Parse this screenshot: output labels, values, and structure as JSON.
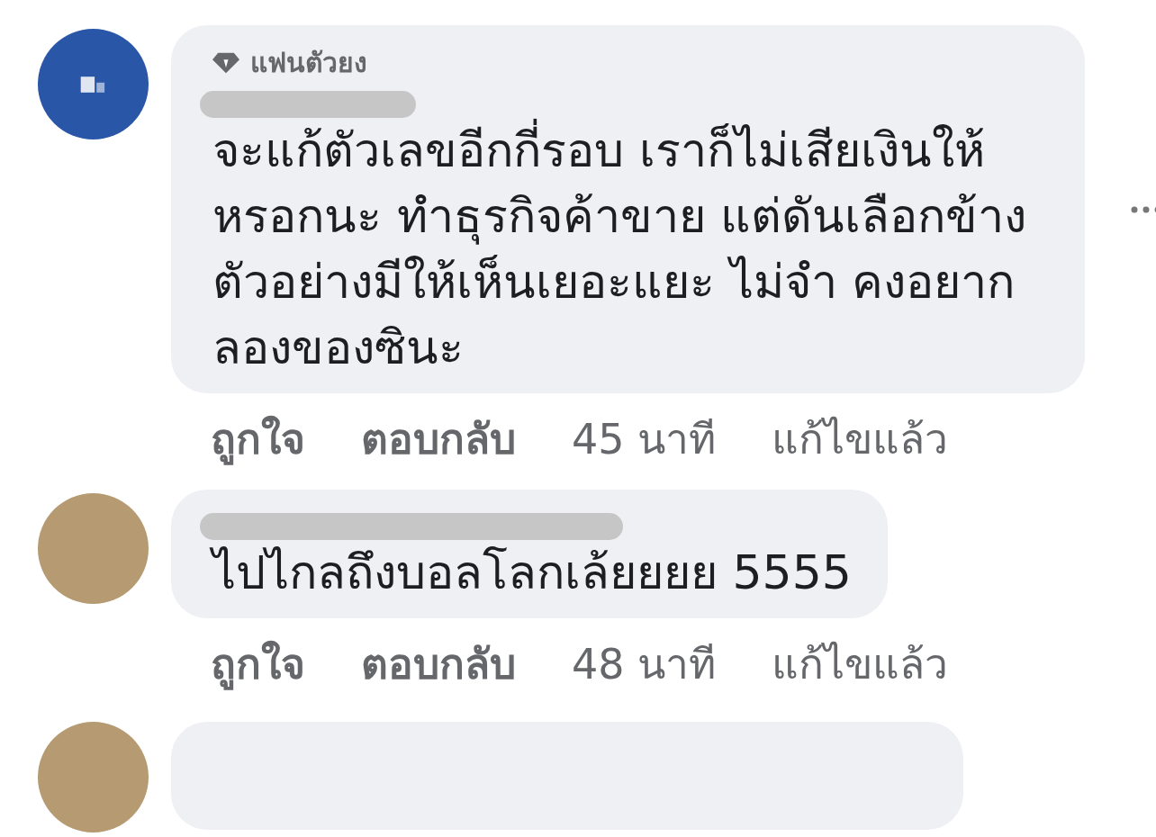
{
  "comments": [
    {
      "kind": "full",
      "avatar": {
        "kind": "logo"
      },
      "badge": "แฟนตัวยง",
      "name_redacted": true,
      "text": "จะแก้ตัวเลขอีกกี่รอบ เราก็ไม่เสียเงินให้หรอกนะ ทำธุรกิจค้าขาย แต่ดันเลือกข้าง ตัวอย่างมีให้เห็นเยอะแยะ ไม่จำ คงอยากลองของซินะ",
      "menu": true,
      "actions": [
        {
          "label": "ถูกใจ",
          "kind": "link"
        },
        {
          "label": "ตอบกลับ",
          "kind": "link"
        },
        {
          "label": "45 นาที",
          "kind": "time"
        },
        {
          "label": "แก้ไขแล้ว",
          "kind": "note"
        }
      ]
    },
    {
      "kind": "full",
      "avatar": {
        "kind": "photo"
      },
      "name_redacted": true,
      "text": "ไปไกลถึงบอลโลกเล้ยยยย 5555",
      "menu": false,
      "actions": [
        {
          "label": "ถูกใจ",
          "kind": "link"
        },
        {
          "label": "ตอบกลับ",
          "kind": "link"
        },
        {
          "label": "48 นาที",
          "kind": "time"
        },
        {
          "label": "แก้ไขแล้ว",
          "kind": "note"
        }
      ]
    },
    {
      "kind": "cut",
      "avatar": {
        "kind": "photo"
      }
    }
  ]
}
